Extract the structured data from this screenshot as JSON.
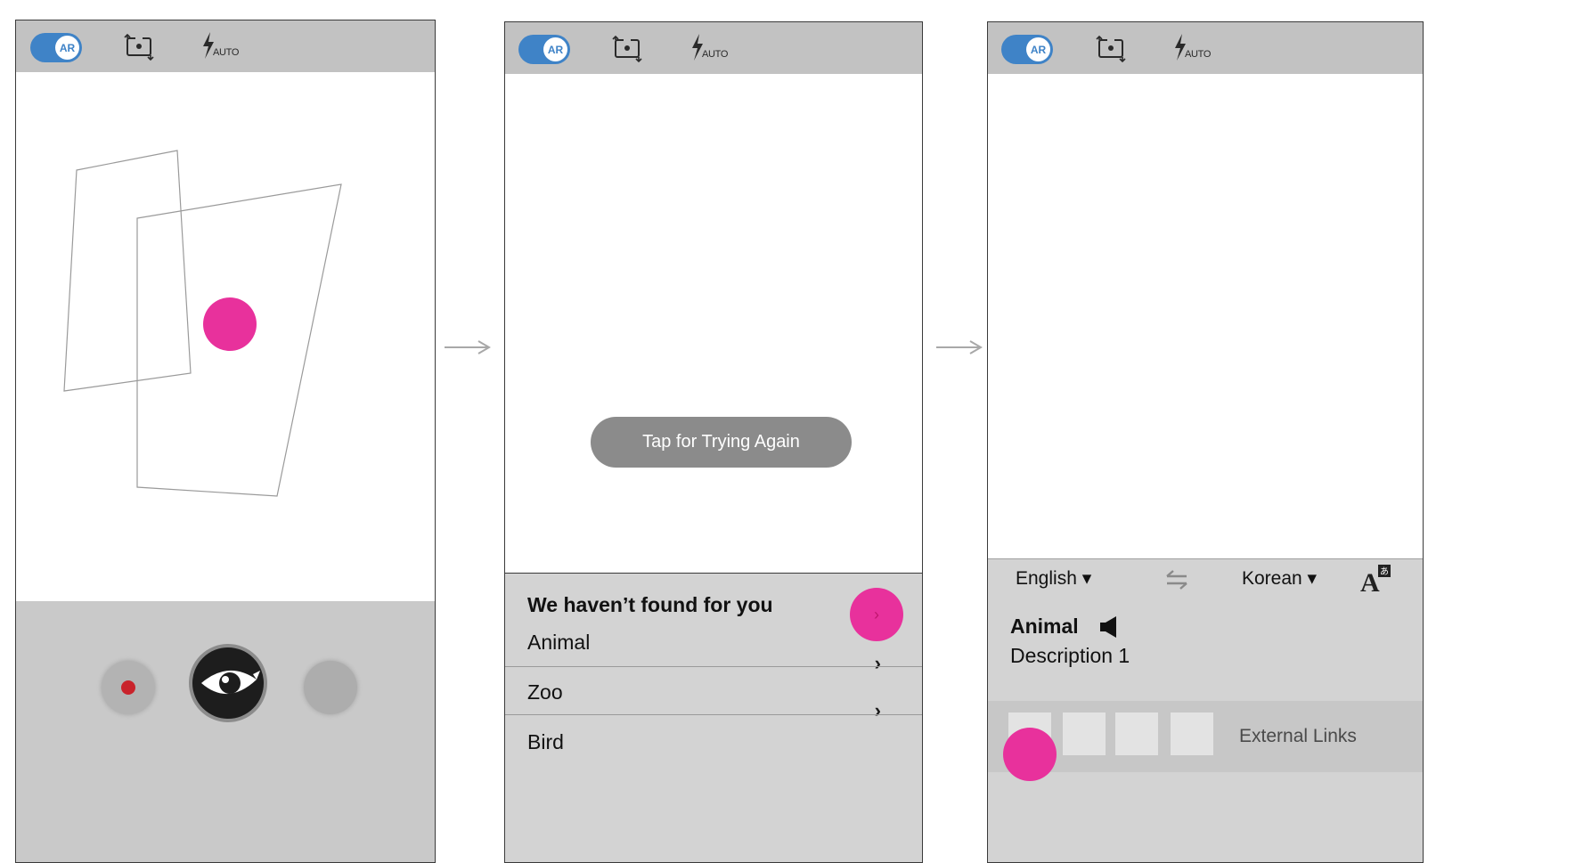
{
  "common": {
    "ar_toggle_label": "AR",
    "flash_label": "AUTO",
    "accent_color": "#e8319c",
    "toggle_color": "#3f83c7"
  },
  "screen2": {
    "retry_label": "Tap for Trying Again",
    "results_title": "We haven’t found for you",
    "results": [
      "Animal",
      "Zoo",
      "Bird"
    ],
    "go_icon": "chevron-right-icon"
  },
  "screen3": {
    "source_language": "English ▾",
    "target_language": "Korean ▾",
    "word_title": "Animal",
    "word_description": "Description 1",
    "external_links_label": "External Links"
  }
}
